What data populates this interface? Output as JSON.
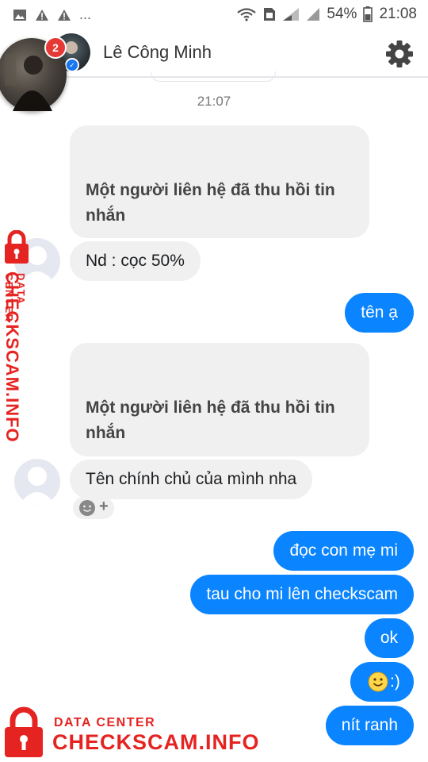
{
  "status_bar": {
    "battery": "54%",
    "time": "21:08",
    "left_icons": [
      "image-icon",
      "warning-icon",
      "warning-icon"
    ],
    "more": "..."
  },
  "header": {
    "contact_name": "Lê Công Minh",
    "chathead_badge": "2"
  },
  "conversation": {
    "timestamp": "21:07",
    "messages": [
      {
        "sender": "them",
        "type": "unsent",
        "text": "Một người liên hệ đã thu hồi tin nhắn"
      },
      {
        "sender": "them",
        "type": "text",
        "text": "Nd : cọc 50%"
      },
      {
        "sender": "me",
        "type": "text",
        "text": "tên ạ"
      },
      {
        "sender": "them",
        "type": "unsent",
        "text": "Một người liên hệ đã thu hồi tin nhắn"
      },
      {
        "sender": "them",
        "type": "text",
        "text": "Tên chính chủ của mình nha"
      },
      {
        "sender": "me",
        "type": "text",
        "text": "đọc con mẹ mi"
      },
      {
        "sender": "me",
        "type": "text",
        "text": "tau cho mi lên checkscam"
      },
      {
        "sender": "me",
        "type": "text",
        "text": "ok"
      },
      {
        "sender": "me",
        "type": "text",
        "text": ":)"
      },
      {
        "sender": "me",
        "type": "text",
        "text": "nít ranh"
      }
    ],
    "reaction_add": "+"
  },
  "watermark": {
    "line1": "DATA CENTER",
    "line2": "CHECKSCAM.INFO"
  },
  "colors": {
    "outgoing": "#0a84ff",
    "incoming": "#f0f0f0",
    "watermark": "#e52421"
  }
}
